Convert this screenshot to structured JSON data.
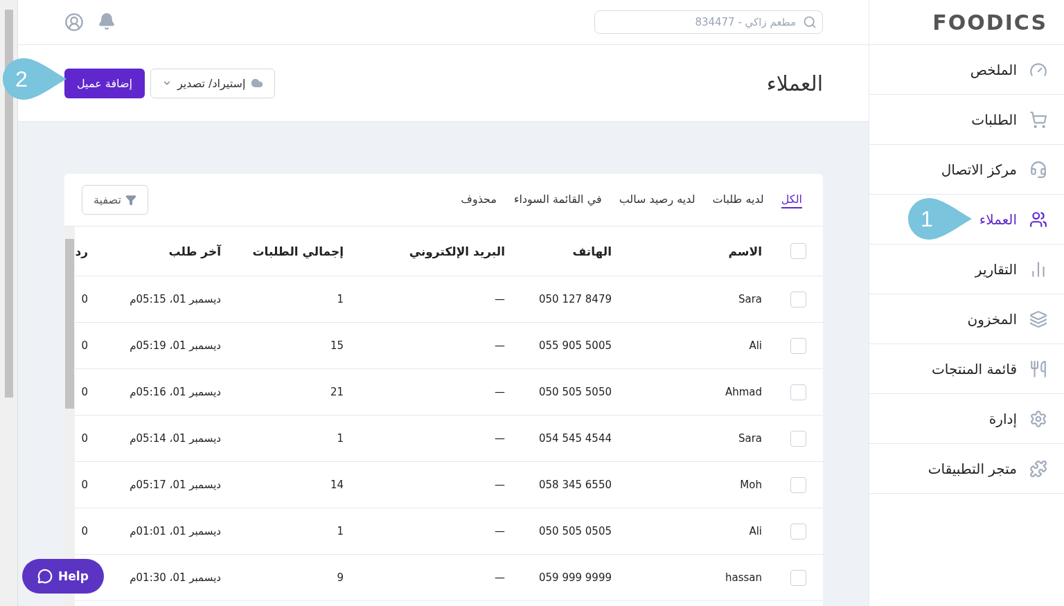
{
  "sidebar": {
    "logo": "FOODICS",
    "items": [
      {
        "label": "الملخص",
        "selected": false
      },
      {
        "label": "الطلبات",
        "selected": false
      },
      {
        "label": "مركز الاتصال",
        "selected": false
      },
      {
        "label": "العملاء",
        "selected": true
      },
      {
        "label": "التقارير",
        "selected": false
      },
      {
        "label": "المخزون",
        "selected": false
      },
      {
        "label": "قائمة المنتجات",
        "selected": false
      },
      {
        "label": "إدارة",
        "selected": false
      },
      {
        "label": "متجر التطبيقات",
        "selected": false
      }
    ]
  },
  "search": {
    "placeholder": "مطعم زاكي - 834477"
  },
  "page_title": "العملاء",
  "import_export_button": "إستيراد/ تصدير",
  "add_customer_button": "إضافة عميل",
  "tabs": [
    {
      "label": "الكل",
      "selected": true
    },
    {
      "label": "لديه طلبات",
      "selected": false
    },
    {
      "label": "لديه رصيد سالب",
      "selected": false
    },
    {
      "label": "في القائمة السوداء",
      "selected": false
    },
    {
      "label": "محذوف",
      "selected": false
    }
  ],
  "filter_button": "تصفية",
  "table": {
    "select_all_checked": false,
    "columns": [
      "الاسم",
      "الهاتف",
      "البريد الإلكتروني",
      "إجمالي الطلبات",
      "آخر طلب",
      "رد"
    ],
    "rows": [
      {
        "checked": false,
        "cells": [
          "Sara",
          "050 127 8479",
          "—",
          "1",
          "ديسمبر 01، 05:15م",
          "0"
        ]
      },
      {
        "checked": false,
        "cells": [
          "Ali",
          "055 905 5005",
          "—",
          "15",
          "ديسمبر 01، 05:19م",
          "0"
        ]
      },
      {
        "checked": false,
        "cells": [
          "Ahmad",
          "050 505 5050",
          "—",
          "21",
          "ديسمبر 01، 05:16م",
          "0"
        ]
      },
      {
        "checked": false,
        "cells": [
          "Sara",
          "054 545 4544",
          "—",
          "1",
          "ديسمبر 01، 05:14م",
          "0"
        ]
      },
      {
        "checked": false,
        "cells": [
          "Moh",
          "058 345 6550",
          "—",
          "14",
          "ديسمبر 01، 05:17م",
          "0"
        ]
      },
      {
        "checked": false,
        "cells": [
          "Ali",
          "050 505 0505",
          "—",
          "1",
          "ديسمبر 01، 01:01م",
          "0"
        ]
      },
      {
        "checked": false,
        "cells": [
          "hassan",
          "059 999 9999",
          "—",
          "9",
          "ديسمبر 01، 01:30م"
        ]
      }
    ]
  },
  "help_button": "Help",
  "callouts": [
    {
      "number": "1"
    },
    {
      "number": "2"
    }
  ]
}
